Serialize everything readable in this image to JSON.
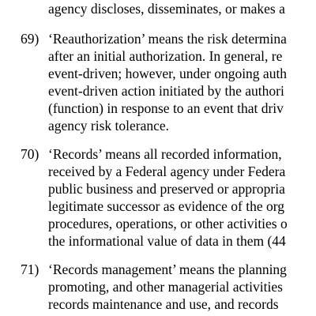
{
  "document": {
    "fragment_top": "agency discloses, disseminates, or makes a",
    "items": [
      {
        "number": "69)",
        "lines": [
          "‘Reauthorization’ means the risk determina",
          "after an initial authorization.  In general, re",
          "event-driven; however, under ongoing auth",
          "event-driven action initiated by the authori",
          "(function) in response to an event that driv",
          "agency risk tolerance."
        ]
      },
      {
        "number": "70)",
        "lines": [
          "‘Records’ means all recorded information,",
          "received by a Federal agency under Federa",
          "public business and preserved or appropria",
          "legitimate successor as evidence of the org",
          "procedures, operations, or other activities o",
          "the informational value of data in them (44"
        ]
      },
      {
        "number": "71)",
        "lines": [
          "‘Records management’ means the planning",
          "promoting, and other managerial activities",
          "records maintenance and use, and records"
        ]
      }
    ]
  }
}
